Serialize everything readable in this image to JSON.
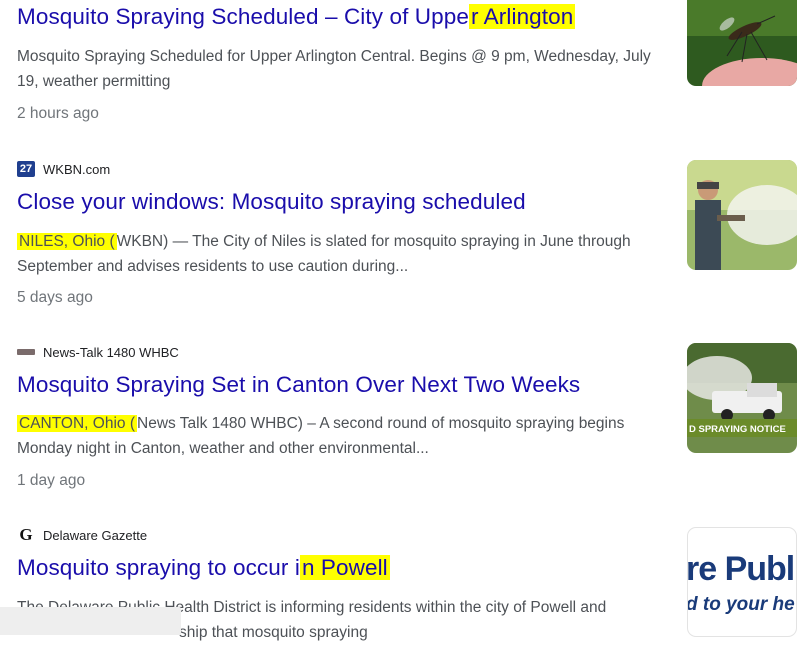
{
  "results": [
    {
      "source": "",
      "title_pre": "Mosquito Spraying Scheduled – City of Uppe",
      "title_hl": "r Arlington",
      "title_post": "",
      "snippet_hl": "",
      "snippet": "Mosquito Spraying Scheduled for Upper Arlington Central. Begins @ 9 pm, Wednesday, July 19, weather permitting",
      "age": "2 hours ago",
      "thumb_icon": "mosquito-image"
    },
    {
      "source": "WKBN.com",
      "source_icon_text": "27",
      "title_pre": "Close your windows: Mosquito spraying scheduled",
      "title_hl": "",
      "title_post": "",
      "snippet_hl": "NILES, Ohio (",
      "snippet": "WKBN) — The City of Niles is slated for mosquito spraying in June through September and advises residents to use caution during...",
      "age": "5 days ago",
      "thumb_icon": "fogging-worker-image"
    },
    {
      "source": "News-Talk 1480 WHBC",
      "title_pre": "Mosquito Spraying Set in Canton Over Next Two Weeks",
      "title_hl": "",
      "title_post": "",
      "snippet_hl": "CANTON, Ohio (",
      "snippet": "News Talk 1480 WHBC) – A second round of mosquito spraying begins Monday night in Canton, weather and other environmental...",
      "age": "1 day ago",
      "thumb_text": "D SPRAYING NOTICE",
      "thumb_icon": "spray-truck-image"
    },
    {
      "source": "Delaware Gazette",
      "source_icon_text": "G",
      "title_pre": "Mosquito spraying to occur i",
      "title_hl": "n Powell",
      "title_post": "",
      "snippet_hl": "",
      "snippet": "The Delaware Public Health District is informing residents within the city of Powell and ... ship that mosquito spraying",
      "snippet_line1": "The Delaware Public Health District is informing residents within the city of Powell and",
      "snippet_line2": "ship that mosquito spraying",
      "age": "",
      "thumb_text_1": "re Public",
      "thumb_text_2": "d to your he",
      "thumb_icon": "public-health-logo-image"
    }
  ],
  "colors": {
    "link": "#1a0dab",
    "highlight": "#ffff00",
    "snippet": "#4d5156",
    "age": "#70757a"
  }
}
